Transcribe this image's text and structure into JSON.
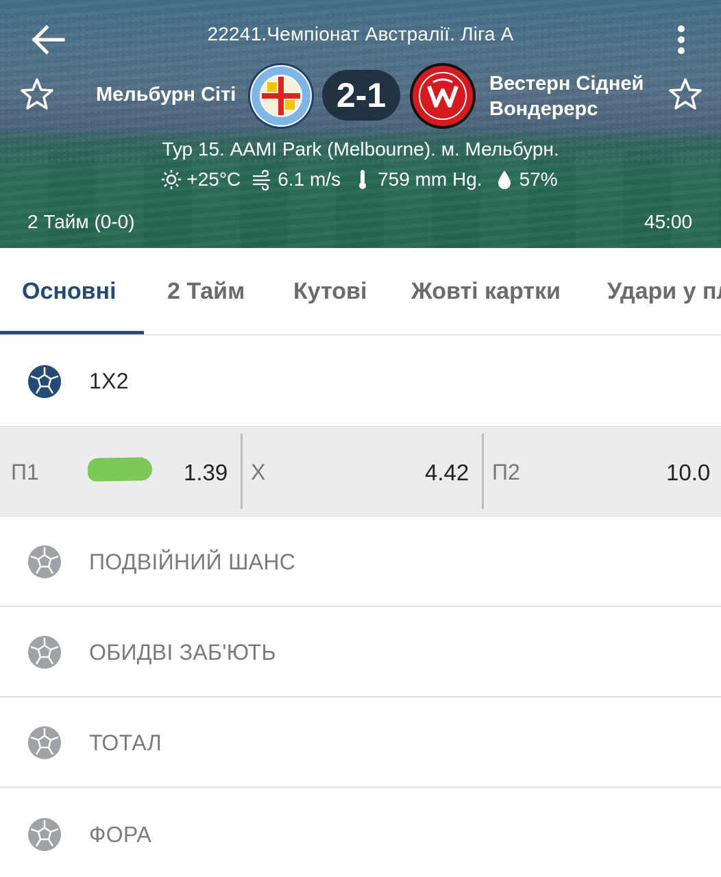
{
  "header": {
    "league_title": "22241.Чемпіонат Австралії. Ліга А",
    "home_team": "Мельбурн Сіті",
    "away_team_line1": "Вестерн Сідней",
    "away_team_line2": "Вондерерс",
    "score": "2-1",
    "venue": "Тур 15. AAMI Park (Melbourne). м. Мельбурн.",
    "weather": {
      "temperature": "+25°C",
      "wind": "6.1 m/s",
      "pressure": "759 mm Hg.",
      "humidity": "57%"
    },
    "period": "2 Тайм (0-0)",
    "clock": "45:00"
  },
  "tabs": [
    {
      "label": "Основні",
      "active": true
    },
    {
      "label": "2 Тайм"
    },
    {
      "label": "Кутові"
    },
    {
      "label": "Жовті картки"
    },
    {
      "label": "Удари у пл"
    }
  ],
  "markets": {
    "main": {
      "title": "1X2",
      "odds": [
        {
          "name": "П1",
          "value": "1.39"
        },
        {
          "name": "Х",
          "value": "4.42"
        },
        {
          "name": "П2",
          "value": "10.0"
        }
      ]
    },
    "others": [
      {
        "label": "ПОДВІЙНИЙ ШАНС"
      },
      {
        "label": "ОБИДВІ ЗАБ'ЮТЬ"
      },
      {
        "label": "ТОТАЛ"
      },
      {
        "label": "ФОРА"
      }
    ]
  },
  "colors": {
    "accent": "#244b76",
    "header_overlay": "#1f5f7e",
    "green_mark": "#7cc85a",
    "away_logo_red": "#d71920",
    "home_logo_blue": "#7fb6e6"
  }
}
